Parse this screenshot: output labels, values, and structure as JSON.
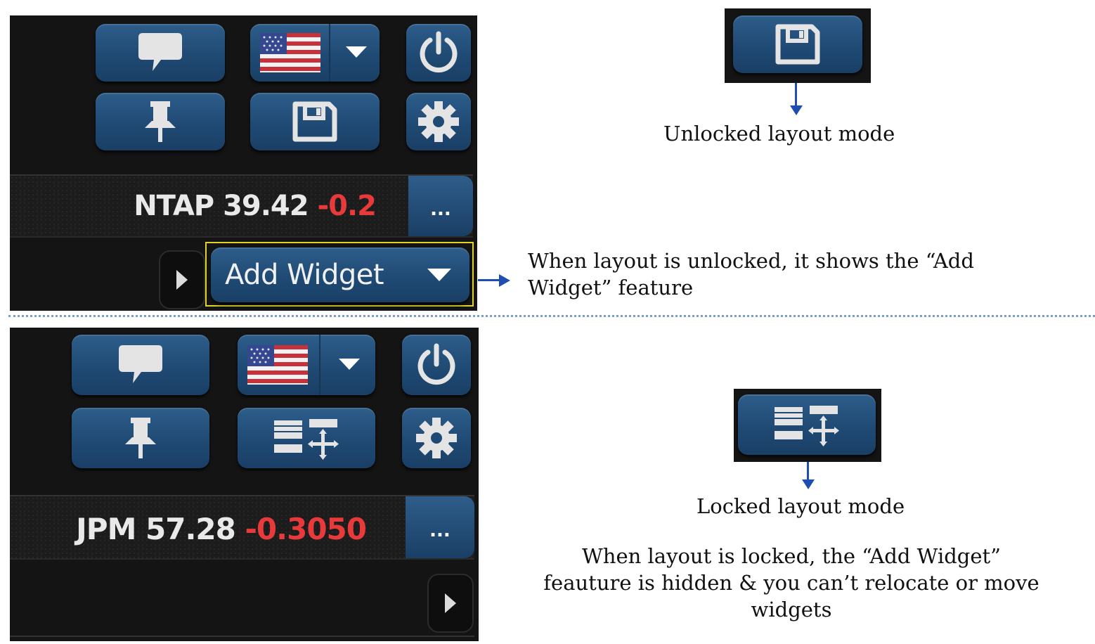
{
  "top_panel": {
    "ticker_symbol": "NTAP",
    "ticker_price": "39.42",
    "ticker_change": "-0.2",
    "more_label": "...",
    "add_widget_label": "Add Widget"
  },
  "bottom_panel": {
    "ticker_symbol": "JPM",
    "ticker_price": "57.28",
    "ticker_change": "-0.3050",
    "more_label": "..."
  },
  "annotations": {
    "unlocked_label": "Unlocked layout mode",
    "unlocked_desc_line1": "When layout is unlocked, it shows the “Add",
    "unlocked_desc_line2": "Widget” feature",
    "locked_label": "Locked layout mode",
    "locked_desc_line1": "When layout is locked, the “Add Widget”",
    "locked_desc_line2": "feauture is hidden & you can’t relocate or move",
    "locked_desc_line3": "widgets"
  },
  "icons": {
    "chat": "speech-bubble-icon",
    "flag": "us-flag-icon",
    "dropdown": "caret-down-icon",
    "power": "power-icon",
    "pin": "pushpin-icon",
    "save": "floppy-disk-icon",
    "layout_lock": "layout-move-icon",
    "settings": "gear-icon",
    "expand": "caret-right-icon"
  },
  "colors": {
    "button_blue": "#1f4a74",
    "negative_red": "#e83a3a",
    "highlight_yellow": "#e0d227",
    "annotation_blue": "#1e4fb0",
    "panel_bg": "#141414"
  }
}
